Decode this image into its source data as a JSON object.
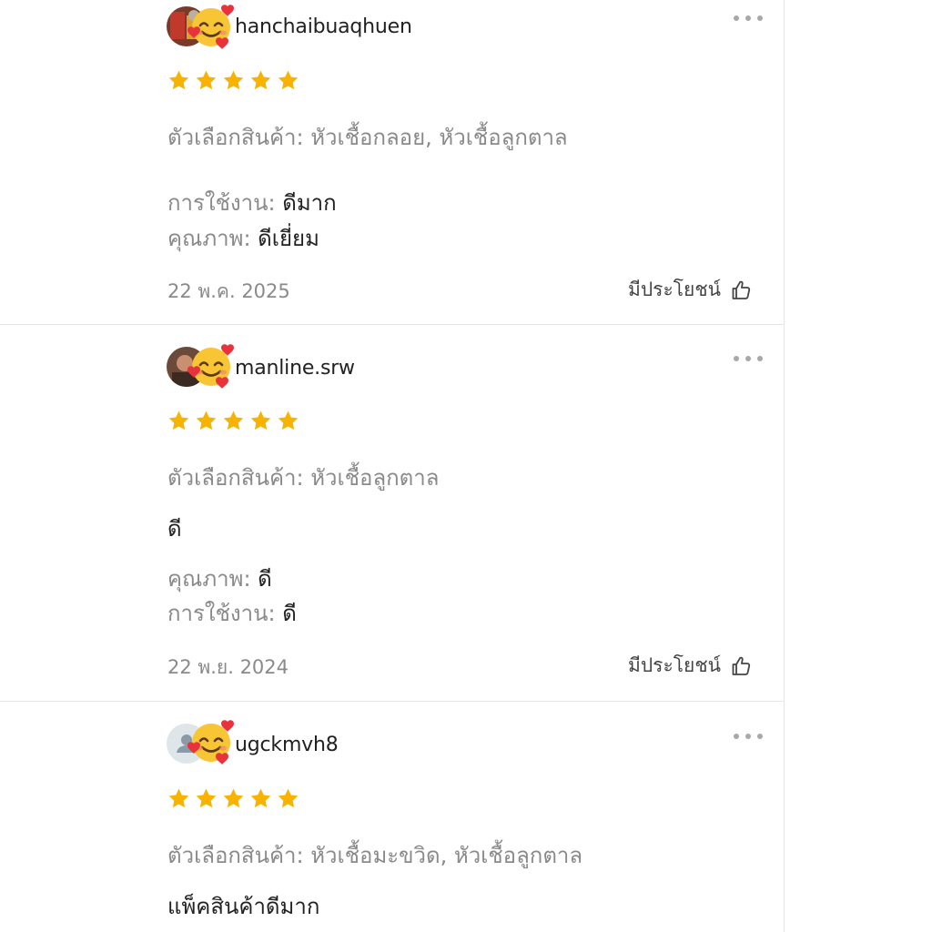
{
  "reviews": [
    {
      "username": "hanchaibuaqhuen",
      "rating": 5,
      "variation_label": "ตัวเลือกสินค้า:",
      "variation_value": "หัวเชื้อกลอย, หัวเชื้อลูกตาล",
      "attr1_label": "การใช้งาน:",
      "attr1_value": "ดีมาก",
      "attr2_label": "คุณภาพ:",
      "attr2_value": "ดีเยี่ยม",
      "date": "22 พ.ค. 2025",
      "helpful_label": "มีประโยชน์"
    },
    {
      "username": "manline.srw",
      "rating": 5,
      "variation_label": "ตัวเลือกสินค้า:",
      "variation_value": "หัวเชื้อลูกตาล",
      "comment": "ดี",
      "attr1_label": "คุณภาพ:",
      "attr1_value": "ดี",
      "attr2_label": "การใช้งาน:",
      "attr2_value": "ดี",
      "date": "22 พ.ย. 2024",
      "helpful_label": "มีประโยชน์"
    },
    {
      "username": "ugckmvh8",
      "rating": 5,
      "variation_label": "ตัวเลือกสินค้า:",
      "variation_value": "หัวเชื้อมะขวิด, หัวเชื้อลูกตาล",
      "comment": "แพ็คสินค้าดีมาก"
    }
  ],
  "colors": {
    "star": "#f7b300",
    "divider": "#e6e6e6",
    "muted_text": "#8a8a8a"
  },
  "icons": {
    "more": "more-dots-icon",
    "like": "thumbs-up-icon",
    "star": "star-icon",
    "emoji": "smiling-face-with-hearts-icon"
  }
}
